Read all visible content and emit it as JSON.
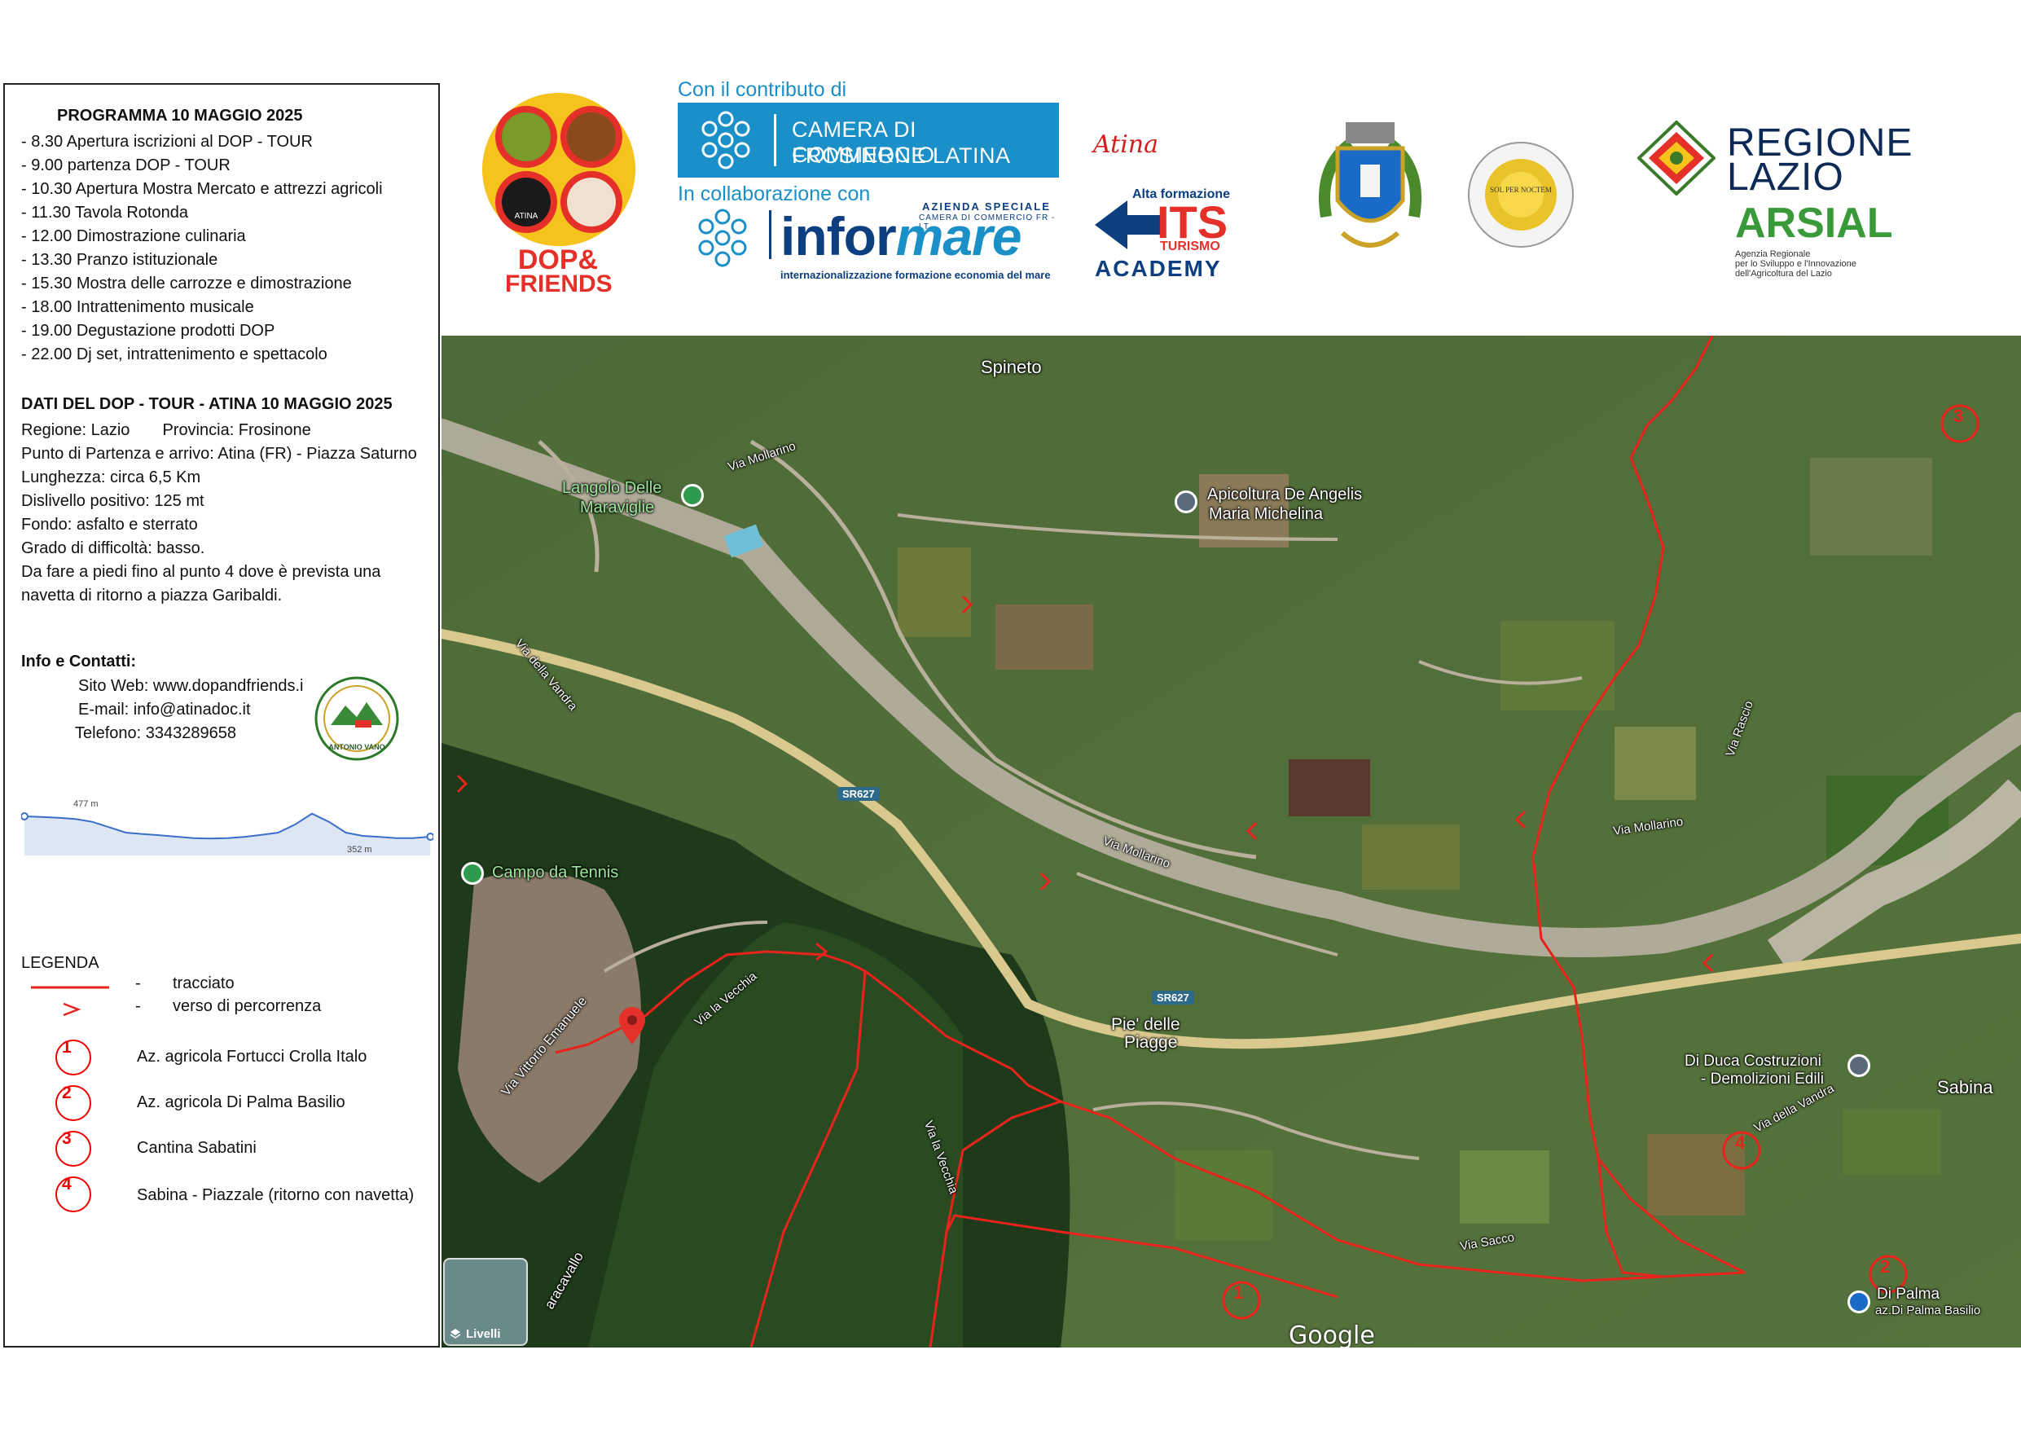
{
  "program": {
    "title": "PROGRAMMA 10 MAGGIO 2025",
    "items": [
      "-    8.30 Apertura iscrizioni al DOP - TOUR",
      "-    9.00 partenza DOP - TOUR",
      "- 10.30 Apertura Mostra Mercato e attrezzi agricoli",
      "- 11.30 Tavola Rotonda",
      "- 12.00 Dimostrazione culinaria",
      "- 13.30 Pranzo istituzionale",
      "- 15.30 Mostra delle carrozze e dimostrazione",
      "- 18.00 Intrattenimento musicale",
      "- 19.00 Degustazione prodotti DOP",
      "- 22.00 Dj set, intrattenimento e spettacolo"
    ]
  },
  "dati": {
    "title": "DATI DEL DOP - TOUR - ATINA 10 MAGGIO 2025",
    "regione": "Regione: Lazio",
    "provincia": "Provincia: Frosinone",
    "items": [
      "Punto di Partenza e arrivo: Atina (FR) - Piazza Saturno",
      "Lunghezza: circa 6,5 Km",
      "Dislivello positivo: 125 mt",
      "Fondo: asfalto e sterrato",
      "Grado di difficoltà: basso.",
      "Da fare a piedi fino al punto 4 dove è prevista una",
      "navetta di ritorno a piazza Garibaldi."
    ]
  },
  "info": {
    "title": "Info e Contatti:",
    "items": [
      "Sito Web: www.dopandfriends.i",
      "E-mail: info@atinadoc.it",
      "Telefono: 3343289658"
    ],
    "badge_text": "ANTONIO VANO"
  },
  "profile": {
    "max_label": "477 m",
    "min_label": "352 m",
    "elevation_points": [
      460,
      458,
      455,
      450,
      440,
      420,
      400,
      395,
      390,
      385,
      380,
      378,
      380,
      384,
      392,
      400,
      430,
      470,
      440,
      400,
      388,
      384,
      380,
      380,
      385
    ]
  },
  "legend": {
    "title": "LEGENDA",
    "line_label": "tracciato",
    "arrow_label": "verso di percorrenza",
    "dash": "-",
    "stops": [
      {
        "num": "1",
        "label": "Az. agricola Fortucci Crolla Italo"
      },
      {
        "num": "2",
        "label": "Az. agricola Di Palma Basilio"
      },
      {
        "num": "3",
        "label": "Cantina Sabatini"
      },
      {
        "num": "4",
        "label": " Sabina - Piazzale (ritorno con navetta)"
      }
    ]
  },
  "logos": {
    "dop_friends": "DOP& FRIENDS",
    "dop_line1": "DOP&",
    "dop_line2": "FRIENDS",
    "atina": "ATINA",
    "contributo": "Con il contributo di",
    "camera_line1": "CAMERA DI COMMERCIO",
    "camera_line2": "FROSINONE LATINA",
    "collaborazione": "In collaborazione con",
    "informare_a": "infor",
    "informare_b": "mare",
    "informare_az": "AZIENDA SPECIALE",
    "informare_az2": "CAMERA DI COMMERCIO FR - LT",
    "informare_sub": "internazionalizzazione formazione economia del mare",
    "atina_signature": "Atina",
    "its_alta": "Alta formazione",
    "its_big": "ITS",
    "its_turismo": "TURISMO",
    "its_academy": "ACADEMY",
    "univ_motto": "SOL PER NOCTEM",
    "regione_1": "REGIONE",
    "regione_2": "LAZIO",
    "arsial": "ARSIAL",
    "arsial_sub1": "Agenzia Regionale",
    "arsial_sub2": "per lo Sviluppo e l'Innovazione",
    "arsial_sub3": "dell'Agricoltura del Lazio"
  },
  "map": {
    "places": {
      "spineto": "Spineto",
      "angolo": "Langolo Delle",
      "angolo2": "Maraviglie",
      "apicoltura": "Apicoltura De Angelis",
      "apicoltura2": "Maria Michelina",
      "campo": "Campo da Tennis",
      "pie": "Pie' delle",
      "pie2": "Piagge",
      "diduca": "Di Duca Costruzioni",
      "diduca2": "- Demolizioni Edili",
      "sabina": "Sabina",
      "dipalma": "Di Palma",
      "dipalma2": "az.Di Palma Basilio"
    },
    "roads": {
      "mollarino1": "Via Mollarino",
      "mollarino2": "Via Mollarino",
      "mollarino3": "Via Mollarino",
      "vandra1": "Via della Vandra",
      "vandra2": "Via della Vandra",
      "vecchia1": "Via la Vecchia",
      "vecchia2": "Via la Vecchia",
      "vittorio": "Via Vittorio Emanuele",
      "sacco": "Via Sacco",
      "rascio": "Via Rascio",
      "caracavallo": "aracavallo",
      "sr1": "SR627",
      "sr2": "SR627"
    },
    "stops": [
      "1",
      "2",
      "3",
      "4"
    ],
    "livelli": "Livelli",
    "google": "Google"
  },
  "colors": {
    "route": "#e8231c",
    "accent_blue": "#1a8fc8",
    "navy": "#0c3e80",
    "dop_red": "#e5302a"
  }
}
